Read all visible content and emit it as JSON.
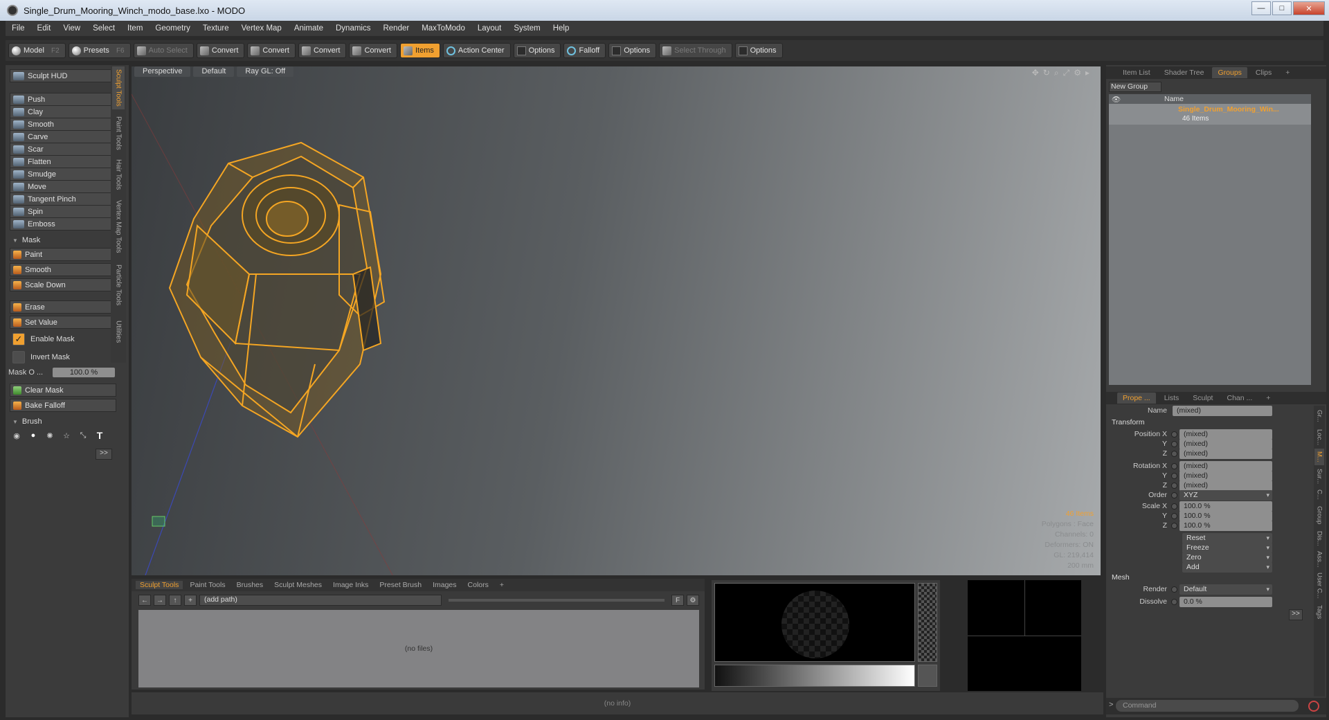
{
  "window": {
    "title": "Single_Drum_Mooring_Winch_modo_base.lxo - MODO"
  },
  "menu": [
    "File",
    "Edit",
    "View",
    "Select",
    "Item",
    "Geometry",
    "Texture",
    "Vertex Map",
    "Animate",
    "Dynamics",
    "Render",
    "MaxToModo",
    "Layout",
    "System",
    "Help"
  ],
  "toolbar": {
    "model": "Model",
    "model_key": "F2",
    "presets": "Presets",
    "presets_key": "F6",
    "auto_select": "Auto Select",
    "convert1": "Convert",
    "convert2": "Convert",
    "convert3": "Convert",
    "convert4": "Convert",
    "items": "Items",
    "action_center": "Action Center",
    "options1": "Options",
    "falloff": "Falloff",
    "options2": "Options",
    "select_through": "Select Through",
    "options3": "Options"
  },
  "sculpt": {
    "hud": "Sculpt HUD",
    "tools": [
      "Push",
      "Clay",
      "Smooth",
      "Carve",
      "Scar",
      "Flatten",
      "Smudge",
      "Move",
      "Tangent Pinch",
      "Spin",
      "Emboss"
    ],
    "mask_title": "Mask",
    "mask_tools": [
      "Paint",
      "Smooth",
      "Scale Down"
    ],
    "mask_tools2": [
      "Erase",
      "Set Value"
    ],
    "enable_mask": "Enable Mask",
    "invert_mask": "Invert Mask",
    "mask_opacity_label": "Mask O ...",
    "mask_opacity_value": "100.0 %",
    "clear_mask": "Clear Mask",
    "bake_falloff": "Bake Falloff",
    "brush_title": "Brush",
    "more": ">>"
  },
  "left_vtabs": [
    "Sculpt Tools",
    "Paint Tools",
    "Hair Tools",
    "Vertex Map Tools",
    "Particle Tools",
    "Utilities"
  ],
  "viewport": {
    "perspective": "Perspective",
    "shading": "Default",
    "raygl": "Ray GL: Off",
    "info": [
      "46 Items",
      "Polygons : Face",
      "Channels: 0",
      "Deformers: ON",
      "GL: 219,414",
      "200 mm"
    ]
  },
  "browser": {
    "tabs": [
      "Sculpt Tools",
      "Paint Tools",
      "Brushes",
      "Sculpt Meshes",
      "Image Inks",
      "Preset Brush",
      "Images",
      "Colors",
      "+"
    ],
    "path": "(add path)",
    "empty": "(no files)"
  },
  "status": "(no info)",
  "groups": {
    "tabs": [
      "Item List",
      "Shader Tree",
      "Groups",
      "Clips",
      "+"
    ],
    "new_group": "New Group",
    "col_name": "Name",
    "item_name": "Single_Drum_Mooring_Win...",
    "item_count": "46 Items"
  },
  "properties": {
    "tabs": [
      "Prope ...",
      "Lists",
      "Sculpt",
      "Chan ...",
      "+"
    ],
    "name_label": "Name",
    "name_value": "(mixed)",
    "transform": "Transform",
    "position_x": "Position X",
    "position_y": "Y",
    "position_z": "Z",
    "pos_vals": [
      "(mixed)",
      "(mixed)",
      "(mixed)"
    ],
    "rotation_x": "Rotation X",
    "rotation_y": "Y",
    "rotation_z": "Z",
    "rot_vals": [
      "(mixed)",
      "(mixed)",
      "(mixed)"
    ],
    "order_label": "Order",
    "order_value": "XYZ",
    "scale_x": "Scale X",
    "scale_y": "Y",
    "scale_z": "Z",
    "scale_vals": [
      "100.0 %",
      "100.0 %",
      "100.0 %"
    ],
    "reset": "Reset",
    "freeze": "Freeze",
    "zero": "Zero",
    "add": "Add",
    "mesh": "Mesh",
    "render_label": "Render",
    "render_value": "Default",
    "dissolve_label": "Dissolve",
    "dissolve_value": "0.0 %",
    "more": ">>"
  },
  "right_vtabs": [
    "Gr...",
    "Loc...",
    "M...",
    "Sur...",
    "C...",
    "Group",
    "Dis...",
    "Ass...",
    "User C...",
    "Tags"
  ],
  "command": {
    "placeholder": "Command"
  },
  "colors": {
    "accent": "#f0a030",
    "mesh": "#f5a623"
  }
}
